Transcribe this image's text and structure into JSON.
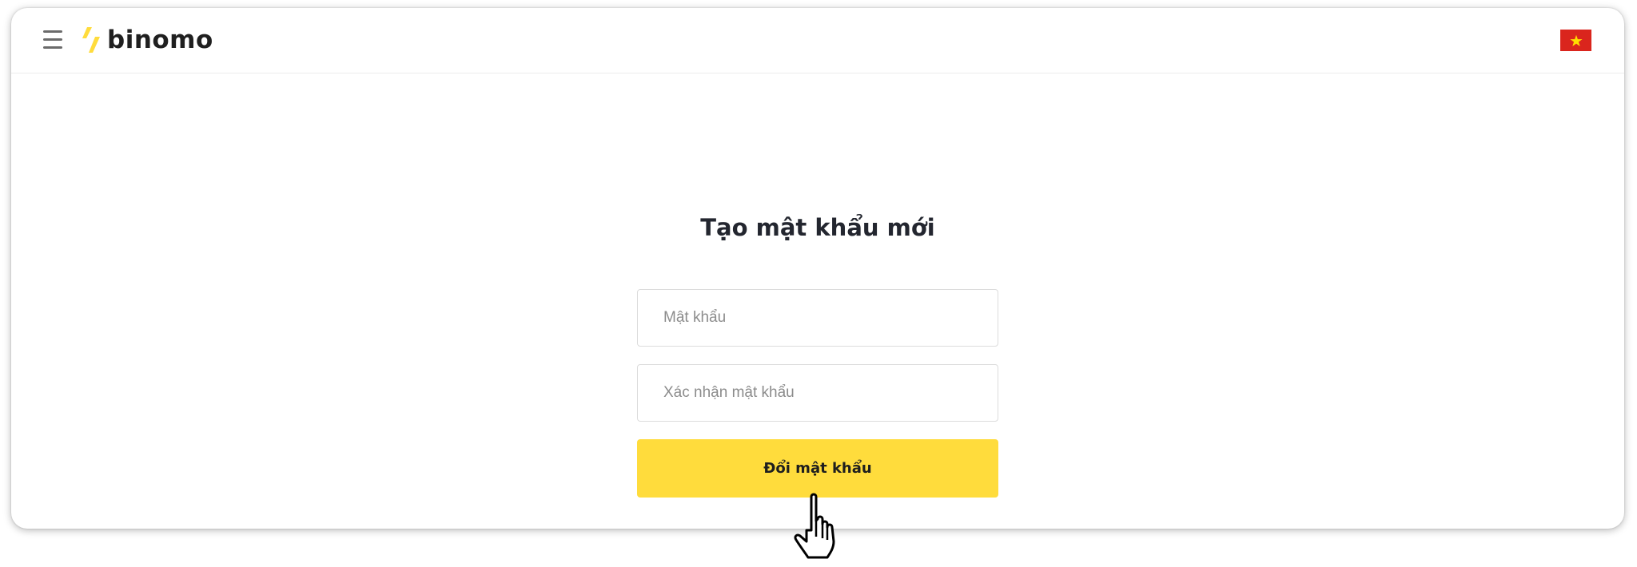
{
  "header": {
    "logo_text": "binomo",
    "language_flag": "vietnam-flag-icon",
    "menu_icon": "hamburger-menu-icon"
  },
  "form": {
    "title": "Tạo mật khẩu mới",
    "password_placeholder": "Mật khẩu",
    "password_value": "",
    "confirm_placeholder": "Xác nhận mật khẩu",
    "confirm_value": "",
    "submit_label": "Đổi mật khẩu"
  },
  "colors": {
    "accent": "#ffdc3c",
    "logo_mark": "#ffdc3c",
    "flag_red": "#da251d",
    "flag_star": "#ffde00",
    "text_dark": "#23262f"
  },
  "cursor": {
    "icon": "hand-pointer-cursor-icon"
  }
}
